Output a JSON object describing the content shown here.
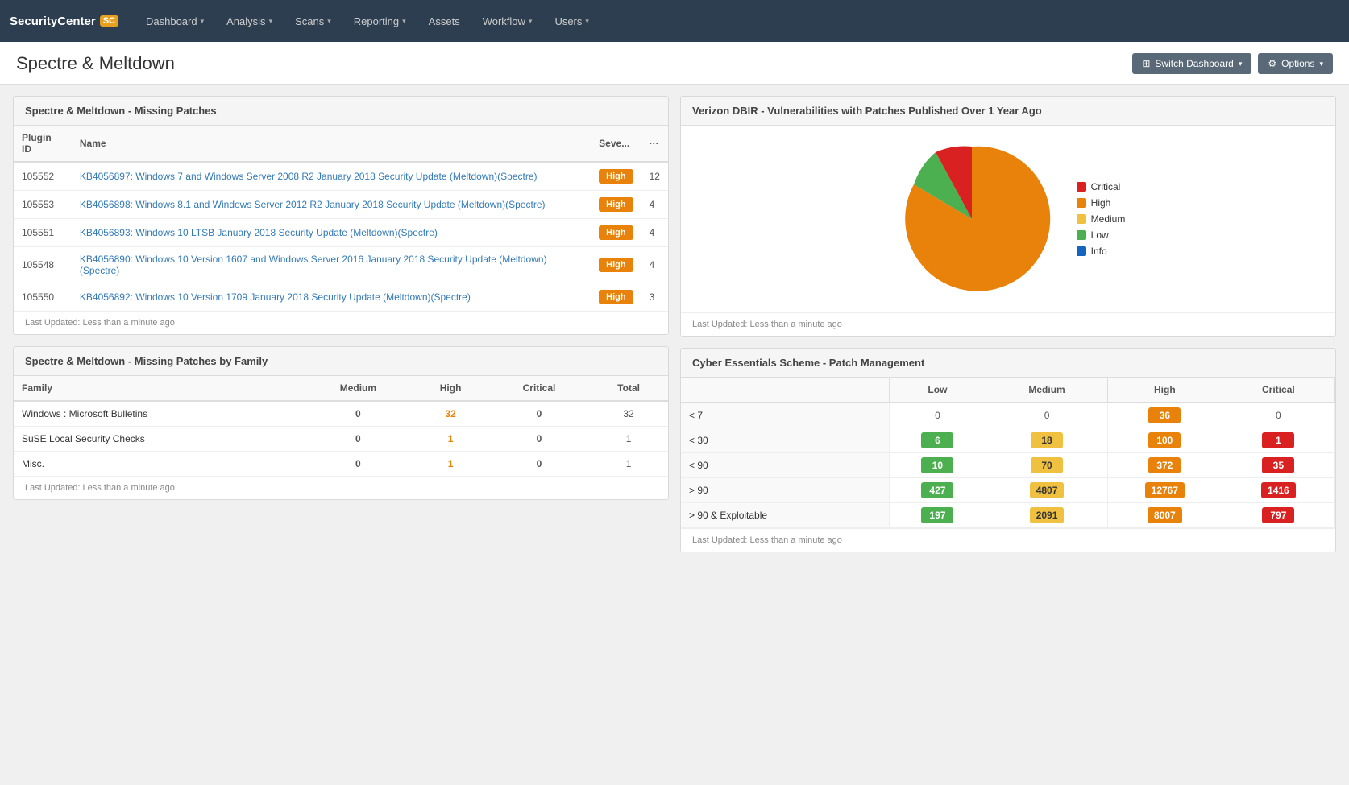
{
  "brand": {
    "name": "SecurityCenter",
    "badge": "SC"
  },
  "nav": {
    "items": [
      {
        "label": "Dashboard",
        "hasDropdown": true
      },
      {
        "label": "Analysis",
        "hasDropdown": true
      },
      {
        "label": "Scans",
        "hasDropdown": true
      },
      {
        "label": "Reporting",
        "hasDropdown": true
      },
      {
        "label": "Assets",
        "hasDropdown": false
      },
      {
        "label": "Workflow",
        "hasDropdown": true
      },
      {
        "label": "Users",
        "hasDropdown": true
      }
    ]
  },
  "page": {
    "title": "Spectre & Meltdown",
    "switch_dashboard_label": "Switch Dashboard",
    "options_label": "Options"
  },
  "missing_patches": {
    "title": "Spectre &amp; Meltdown - Missing Patches",
    "columns": [
      "Plugin ID",
      "Name",
      "Seve...",
      "..."
    ],
    "rows": [
      {
        "id": "105552",
        "name": "KB4056897: Windows 7 and Windows Server 2008 R2 January 2018 Security Update (Meltdown)(Spectre)",
        "severity": "High",
        "count": "12"
      },
      {
        "id": "105553",
        "name": "KB4056898: Windows 8.1 and Windows Server 2012 R2 January 2018 Security Update (Meltdown)(Spectre)",
        "severity": "High",
        "count": "4"
      },
      {
        "id": "105551",
        "name": "KB4056893: Windows 10 LTSB January 2018 Security Update (Meltdown)(Spectre)",
        "severity": "High",
        "count": "4"
      },
      {
        "id": "105548",
        "name": "KB4056890: Windows 10 Version 1607 and Windows Server 2016 January 2018 Security Update (Meltdown)(Spectre)",
        "severity": "High",
        "count": "4"
      },
      {
        "id": "105550",
        "name": "KB4056892: Windows 10 Version 1709 January 2018 Security Update (Meltdown)(Spectre)",
        "severity": "High",
        "count": "3"
      }
    ],
    "last_updated": "Last Updated: Less than a minute ago"
  },
  "missing_patches_family": {
    "title": "Spectre &amp; Meltdown - Missing Patches by Family",
    "columns": [
      "Family",
      "Medium",
      "High",
      "Critical",
      "Total"
    ],
    "rows": [
      {
        "family": "Windows : Microsoft Bulletins",
        "medium": "0",
        "high": "32",
        "critical": "0",
        "total": "32"
      },
      {
        "family": "SuSE Local Security Checks",
        "medium": "0",
        "high": "1",
        "critical": "0",
        "total": "1"
      },
      {
        "family": "Misc.",
        "medium": "0",
        "high": "1",
        "critical": "0",
        "total": "1"
      }
    ],
    "last_updated": "Last Updated: Less than a minute ago"
  },
  "pie_chart": {
    "title": "Verizon DBIR - Vulnerabilities with Patches Published Over 1 Year Ago",
    "legend": [
      {
        "label": "Critical",
        "color": "#d92121"
      },
      {
        "label": "High",
        "color": "#e8820a"
      },
      {
        "label": "Medium",
        "color": "#f0c040"
      },
      {
        "label": "Low",
        "color": "#4caf50"
      },
      {
        "label": "Info",
        "color": "#1565c0"
      }
    ],
    "last_updated": "Last Updated: Less than a minute ago"
  },
  "patch_management": {
    "title": "Cyber Essentials Scheme - Patch Management",
    "col_headers": [
      "",
      "Low",
      "Medium",
      "High",
      "Critical"
    ],
    "rows": [
      {
        "label": "< 7",
        "low": "",
        "medium": "",
        "high": "36",
        "critical": ""
      },
      {
        "label": "< 30",
        "low": "6",
        "medium": "18",
        "high": "100",
        "critical": "1"
      },
      {
        "label": "< 90",
        "low": "10",
        "medium": "70",
        "high": "372",
        "critical": "35"
      },
      {
        "label": "> 90",
        "low": "427",
        "medium": "4807",
        "high": "12767",
        "critical": "1416"
      },
      {
        "label": "> 90 & Exploitable",
        "low": "197",
        "medium": "2091",
        "high": "8007",
        "critical": "797"
      }
    ],
    "last_updated": "Last Updated: Less than a minute ago"
  }
}
